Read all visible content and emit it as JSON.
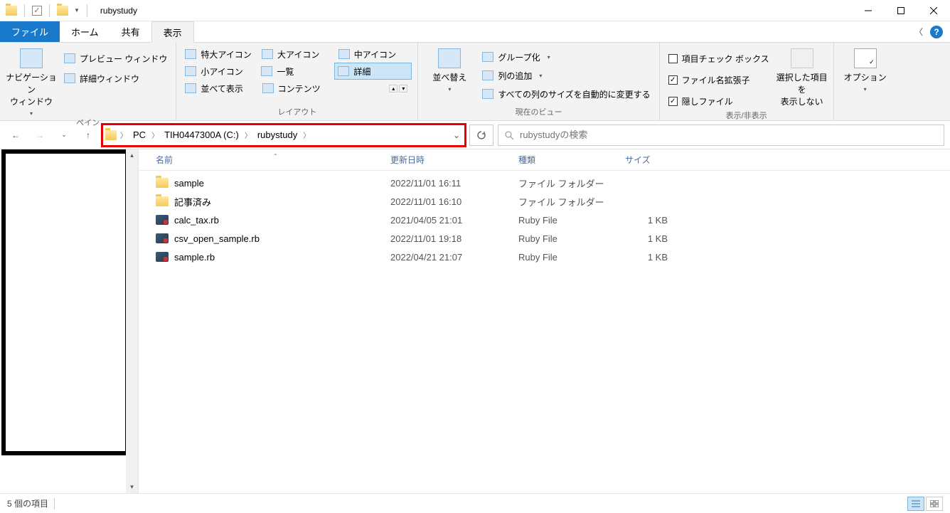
{
  "title": "rubystudy",
  "tabs": {
    "file": "ファイル",
    "home": "ホーム",
    "share": "共有",
    "view": "表示"
  },
  "ribbon": {
    "panes": {
      "label": "ペイン",
      "nav": "ナビゲーション\nウィンドウ",
      "preview": "プレビュー ウィンドウ",
      "details": "詳細ウィンドウ"
    },
    "layout": {
      "label": "レイアウト",
      "xl": "特大アイコン",
      "l": "大アイコン",
      "m": "中アイコン",
      "s": "小アイコン",
      "list": "一覧",
      "detail": "詳細",
      "tile": "並べて表示",
      "content": "コンテンツ"
    },
    "current": {
      "label": "現在のビュー",
      "sort": "並べ替え",
      "group": "グループ化",
      "addcol": "列の追加",
      "autosize": "すべての列のサイズを自動的に変更する"
    },
    "showhide": {
      "label": "表示/非表示",
      "checkboxes": "項目チェック ボックス",
      "ext": "ファイル名拡張子",
      "hidden": "隠しファイル",
      "hidesel": "選択した項目を\n表示しない"
    },
    "options": "オプション"
  },
  "breadcrumb": [
    "PC",
    "TIH0447300A (C:)",
    "rubystudy"
  ],
  "search_placeholder": "rubystudyの検索",
  "columns": {
    "name": "名前",
    "date": "更新日時",
    "type": "種類",
    "size": "サイズ"
  },
  "files": [
    {
      "icon": "folder",
      "name": "sample",
      "date": "2022/11/01 16:11",
      "type": "ファイル フォルダー",
      "size": ""
    },
    {
      "icon": "folder",
      "name": "記事済み",
      "date": "2022/11/01 16:10",
      "type": "ファイル フォルダー",
      "size": ""
    },
    {
      "icon": "ruby",
      "name": "calc_tax.rb",
      "date": "2021/04/05 21:01",
      "type": "Ruby File",
      "size": "1 KB"
    },
    {
      "icon": "ruby",
      "name": "csv_open_sample.rb",
      "date": "2022/11/01 19:18",
      "type": "Ruby File",
      "size": "1 KB"
    },
    {
      "icon": "ruby",
      "name": "sample.rb",
      "date": "2022/04/21 21:07",
      "type": "Ruby File",
      "size": "1 KB"
    }
  ],
  "status": "5 個の項目"
}
